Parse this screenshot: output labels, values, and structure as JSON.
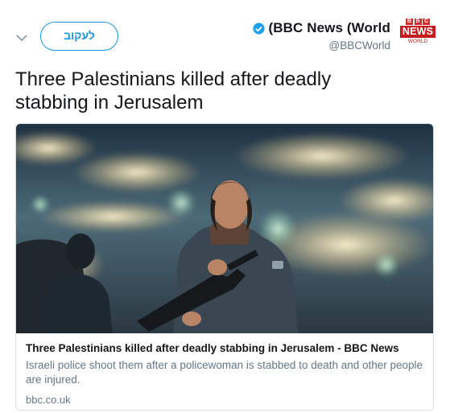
{
  "header": {
    "follow_label": "לעקוב",
    "display_name": "(BBC News (World",
    "handle": "@BBCWorld",
    "verified_icon": "verified-badge-icon",
    "menu_icon": "chevron-down-icon"
  },
  "avatar": {
    "bbc_letters": [
      "B",
      "B",
      "C"
    ],
    "news": "NEWS",
    "world": "WORLD"
  },
  "tweet": {
    "text": "Three Palestinians killed after deadly stabbing in Jerusalem"
  },
  "card": {
    "title": "Three Palestinians killed after deadly stabbing in Jerusalem - BBC News",
    "description": "Israeli police shoot them after a policewoman is stabbed to death and other people are injured.",
    "domain": "bbc.co.uk"
  },
  "colors": {
    "accent": "#1b95e0",
    "brand_red": "#c51d1d",
    "secondary_text": "#657786"
  }
}
